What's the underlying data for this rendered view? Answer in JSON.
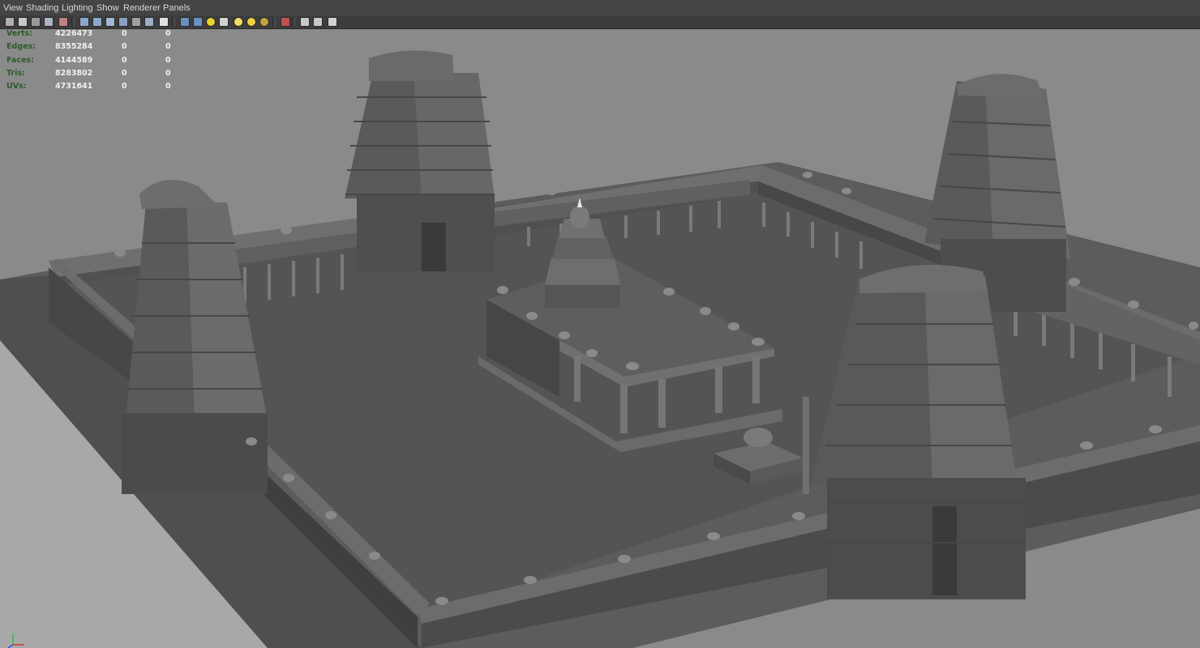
{
  "menu": {
    "items": [
      "View",
      "Shading",
      "Lighting",
      "Show",
      "Renderer",
      "Panels"
    ]
  },
  "toolbar": {
    "icons": [
      "camera-select-icon",
      "camera-attributes-icon",
      "bookmark-icon",
      "image-plane-icon",
      "grease-pencil-icon",
      "grid-icon",
      "film-gate-icon",
      "wireframe-icon",
      "smooth-shade-icon",
      "bounding-box-icon",
      "textured-icon",
      "text-icon",
      "xray-icon",
      "shaded-cube-icon",
      "use-lights-icon",
      "checker-icon",
      "default-light-icon",
      "all-lights-icon",
      "shadows-icon",
      "isolate-select-icon",
      "single-view-icon",
      "multi-view-icon",
      "hypershade-icon"
    ]
  },
  "hud": {
    "rows": [
      {
        "label": "Verts:",
        "value": "4226473",
        "sel": "0",
        "comp": "0"
      },
      {
        "label": "Edges:",
        "value": "8355284",
        "sel": "0",
        "comp": "0"
      },
      {
        "label": "Faces:",
        "value": "4144589",
        "sel": "0",
        "comp": "0"
      },
      {
        "label": "Tris:",
        "value": "8283802",
        "sel": "0",
        "comp": "0"
      },
      {
        "label": "UVs:",
        "value": "4731641",
        "sel": "0",
        "comp": "0"
      }
    ]
  },
  "colors": {
    "viewport_bg": "#8a8a8a",
    "ground": "#595959",
    "wall_top": "#6a6a6a",
    "wall_face": "#4d4d4d",
    "tower_light": "#6c6c6c",
    "tower_dark": "#4b4b4b",
    "hud_label": "#2c5a2c",
    "hud_value": "#f0f0f0",
    "axis_x": "#e03030",
    "axis_y": "#30c030",
    "axis_z": "#3050e0"
  }
}
